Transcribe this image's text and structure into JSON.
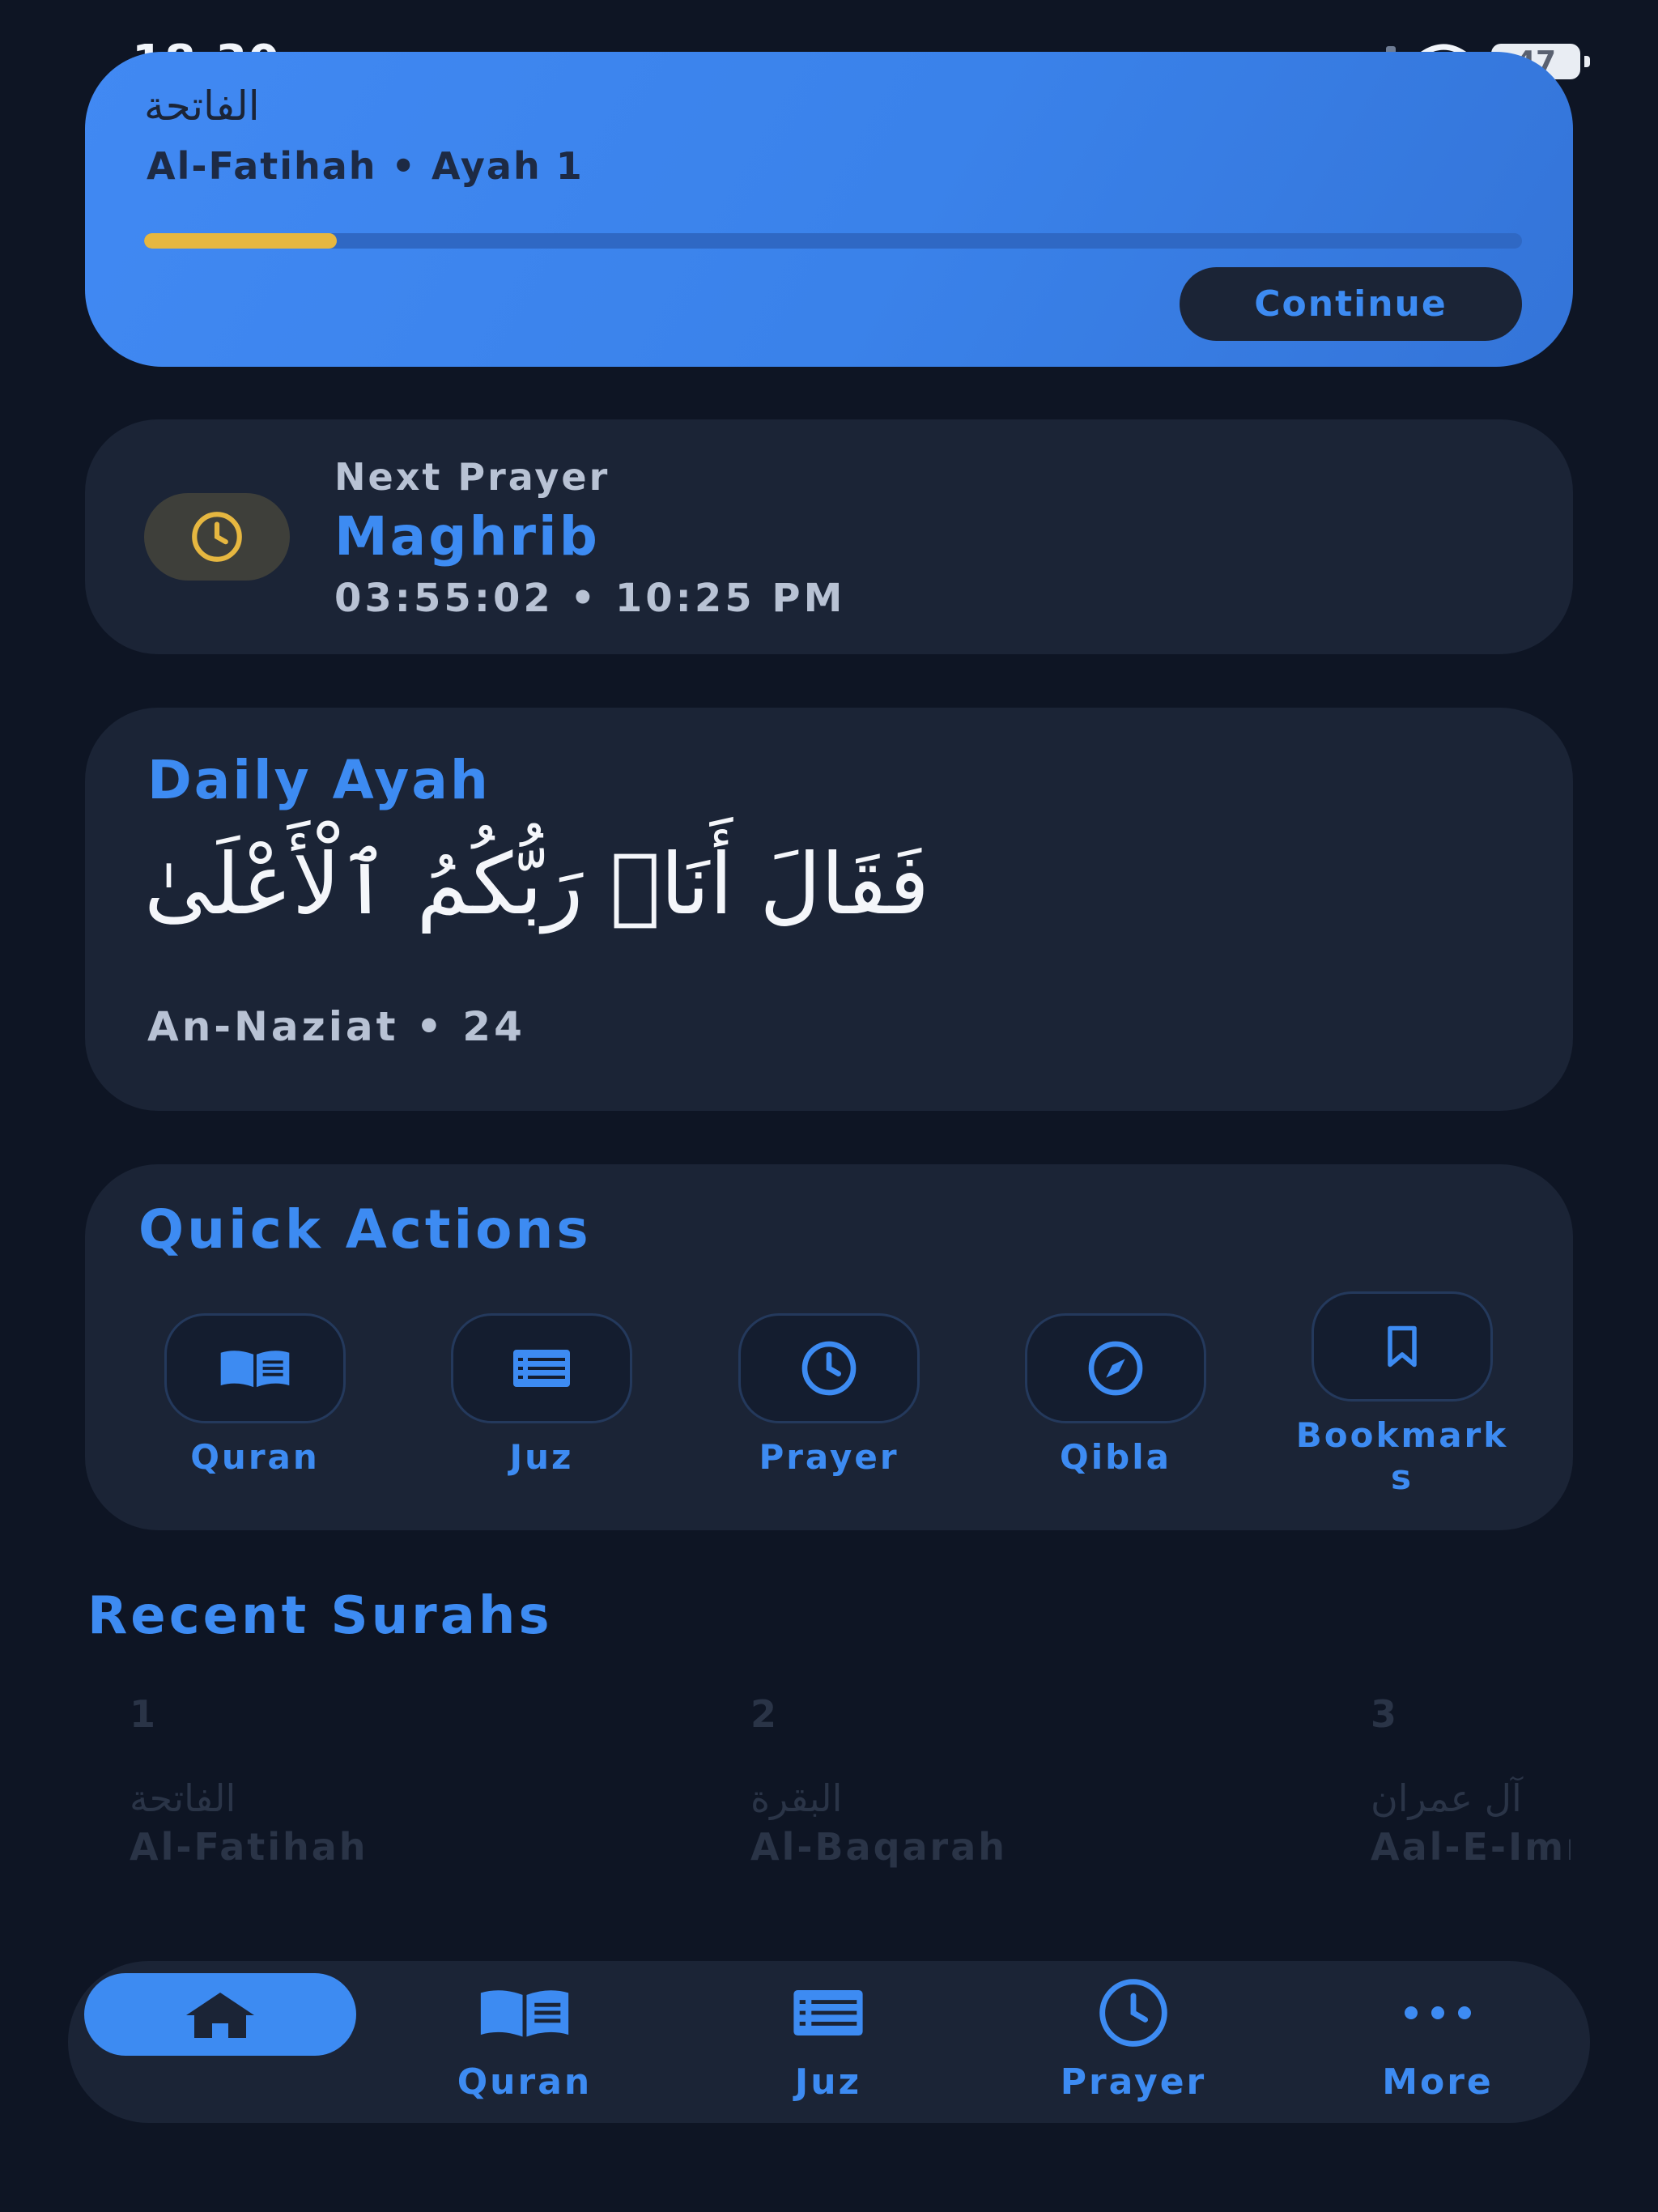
{
  "status_bar": {
    "time": "18:30",
    "battery": "47"
  },
  "continue_card": {
    "surah_arabic": "الفاتحة",
    "subtitle": "Al-Fatihah • Ayah 1",
    "progress": 0.14,
    "button_label": "Continue",
    "accent_color": "#3d8bf2",
    "progress_color": "#e6b740"
  },
  "next_prayer": {
    "label": "Next Prayer",
    "name": "Maghrib",
    "countdown": "03:55:02 • 10:25 PM"
  },
  "daily_ayah": {
    "title": "Daily Ayah",
    "arabic": "فَقَالَ أَنَا۠ رَبُّكُمُ ٱلْأَعْلَىٰ",
    "reference": "An-Naziat • 24"
  },
  "quick_actions": {
    "title": "Quick Actions",
    "items": [
      {
        "label": "Quran",
        "icon": "book-open-icon"
      },
      {
        "label": "Juz",
        "icon": "list-icon"
      },
      {
        "label": "Prayer",
        "icon": "clock-icon"
      },
      {
        "label": "Qibla",
        "icon": "compass-icon"
      },
      {
        "label": "Bookmarks",
        "icon": "bookmark-icon"
      }
    ]
  },
  "recent_surahs": {
    "title": "Recent Surahs",
    "items": [
      {
        "number": "1",
        "arabic": "الفاتحة",
        "name": "Al-Fatihah"
      },
      {
        "number": "2",
        "arabic": "البقرة",
        "name": "Al-Baqarah"
      },
      {
        "number": "3",
        "arabic": "آل عمران",
        "name": "Aal-E-Imran"
      }
    ]
  },
  "tab_bar": {
    "items": [
      {
        "label": "",
        "icon": "home-icon",
        "active": true
      },
      {
        "label": "Quran",
        "icon": "book-open-icon"
      },
      {
        "label": "Juz",
        "icon": "list-icon"
      },
      {
        "label": "Prayer",
        "icon": "clock-icon"
      },
      {
        "label": "More",
        "icon": "more-dots-icon"
      }
    ]
  }
}
